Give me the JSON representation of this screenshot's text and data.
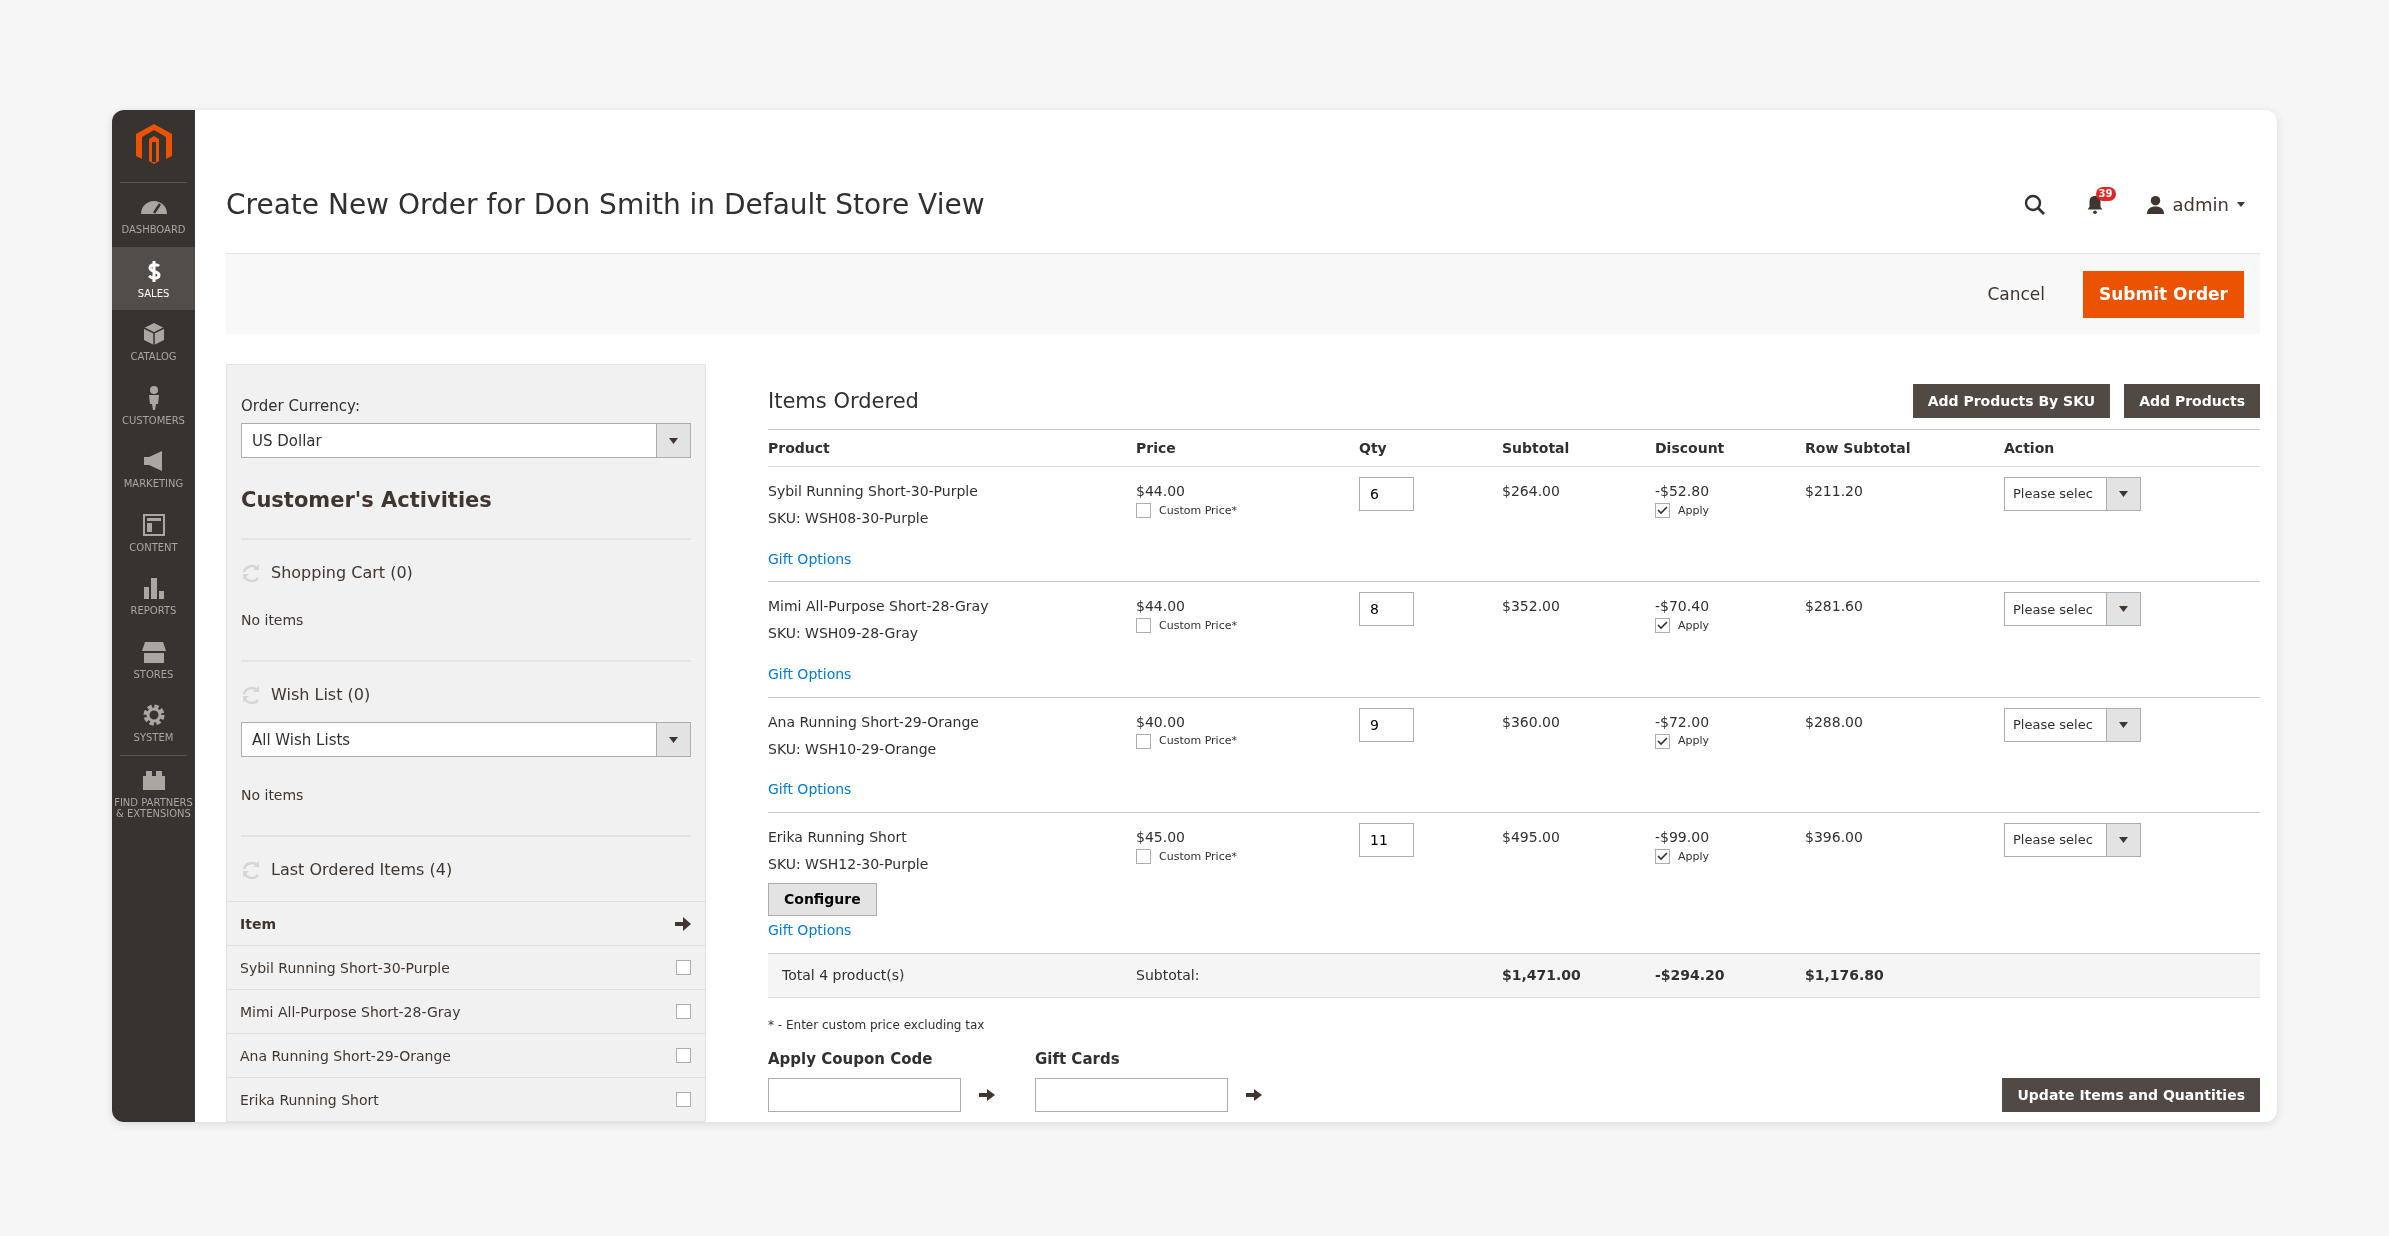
{
  "sidebar": {
    "items": [
      {
        "label": "DASHBOARD",
        "selected": false
      },
      {
        "label": "SALES",
        "selected": true
      },
      {
        "label": "CATALOG",
        "selected": false
      },
      {
        "label": "CUSTOMERS",
        "selected": false
      },
      {
        "label": "MARKETING",
        "selected": false
      },
      {
        "label": "CONTENT",
        "selected": false
      },
      {
        "label": "REPORTS",
        "selected": false
      },
      {
        "label": "STORES",
        "selected": false
      },
      {
        "label": "SYSTEM",
        "selected": false
      },
      {
        "label": "FIND PARTNERS & EXTENSIONS",
        "selected": false
      }
    ]
  },
  "header": {
    "title": "Create New Order for Don Smith in Default Store View",
    "notification_count": "39",
    "user": "admin"
  },
  "page_actions": {
    "cancel": "Cancel",
    "submit": "Submit Order"
  },
  "left_panel": {
    "currency_label": "Order Currency:",
    "currency_value": "US Dollar",
    "activities_title": "Customer's Activities",
    "sections": [
      {
        "kind": "empty",
        "title": "Shopping Cart (0)",
        "empty_text": "No items"
      },
      {
        "kind": "wishlist",
        "title": "Wish List (0)",
        "select_value": "All Wish Lists",
        "empty_text": "No items"
      },
      {
        "kind": "table",
        "title": "Last Ordered Items (4)",
        "column": "Item",
        "rows": [
          {
            "name": "Sybil Running Short-30-Purple",
            "checked": false
          },
          {
            "name": "Mimi All-Purpose Short-28-Gray",
            "checked": false
          },
          {
            "name": "Ana Running Short-29-Orange",
            "checked": false
          },
          {
            "name": "Erika Running Short",
            "checked": false
          }
        ]
      }
    ]
  },
  "items_ordered": {
    "title": "Items Ordered",
    "buttons": [
      "Add Products By SKU",
      "Add Products"
    ],
    "columns": [
      "Product",
      "Price",
      "Qty",
      "Subtotal",
      "Discount",
      "Row Subtotal",
      "Action"
    ],
    "rows": [
      {
        "product": "Sybil Running Short-30-Purple",
        "sku": "SKU: WSH08-30-Purple",
        "configure": null,
        "price": "$44.00",
        "custom_price_label": "Custom Price*",
        "custom_price": false,
        "qty": "6",
        "subtotal": "$264.00",
        "discount": "-$52.80",
        "apply_label": "Apply",
        "apply": true,
        "row_subtotal": "$211.20",
        "action": "Please selec",
        "gift_options": "Gift Options"
      },
      {
        "product": "Mimi All-Purpose Short-28-Gray",
        "sku": "SKU: WSH09-28-Gray",
        "configure": null,
        "price": "$44.00",
        "custom_price_label": "Custom Price*",
        "custom_price": false,
        "qty": "8",
        "subtotal": "$352.00",
        "discount": "-$70.40",
        "apply_label": "Apply",
        "apply": true,
        "row_subtotal": "$281.60",
        "action": "Please selec",
        "gift_options": "Gift Options"
      },
      {
        "product": "Ana Running Short-29-Orange",
        "sku": "SKU: WSH10-29-Orange",
        "configure": null,
        "price": "$40.00",
        "custom_price_label": "Custom Price*",
        "custom_price": false,
        "qty": "9",
        "subtotal": "$360.00",
        "discount": "-$72.00",
        "apply_label": "Apply",
        "apply": true,
        "row_subtotal": "$288.00",
        "action": "Please selec",
        "gift_options": "Gift Options"
      },
      {
        "product": "Erika Running Short",
        "sku": "SKU: WSH12-30-Purple",
        "configure": "Configure",
        "price": "$45.00",
        "custom_price_label": "Custom Price*",
        "custom_price": false,
        "qty": "11",
        "subtotal": "$495.00",
        "discount": "-$99.00",
        "apply_label": "Apply",
        "apply": true,
        "row_subtotal": "$396.00",
        "action": "Please selec",
        "gift_options": "Gift Options"
      }
    ],
    "totals": {
      "label": "Total 4 product(s)",
      "subtotal_label": "Subtotal:",
      "subtotal": "$1,471.00",
      "discount": "-$294.20",
      "row_subtotal": "$1,176.80"
    },
    "note": "* - Enter custom price excluding tax",
    "coupon_label": "Apply Coupon Code",
    "gift_cards_label": "Gift Cards",
    "update_button": "Update Items and Quantities"
  }
}
